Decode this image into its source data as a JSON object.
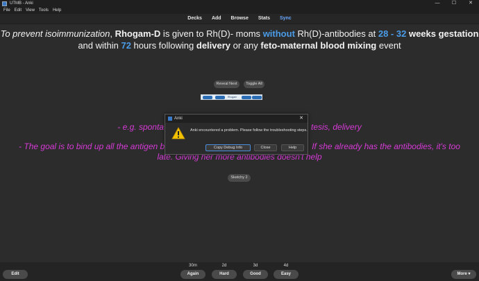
{
  "window": {
    "title": "UTMB - Anki",
    "minimize": "—",
    "maximize": "☐",
    "close": "✕"
  },
  "menu": [
    "File",
    "Edit",
    "View",
    "Tools",
    "Help"
  ],
  "toolbar": {
    "decks": "Decks",
    "add": "Add",
    "browse": "Browse",
    "stats": "Stats",
    "sync": "Sync"
  },
  "card": {
    "l1_a": "To prevent isoimmunization",
    "l1_b": ", ",
    "l1_c": "Rhogam-D",
    "l1_d": " is given to Rh(D)- moms ",
    "l1_e": "without",
    "l1_f": " Rh(D)-antibodies at ",
    "l1_g": "28 - 32",
    "l1_h": " weeks gestation",
    "l2_a": "and within ",
    "l2_b": "72",
    "l2_c": " hours following ",
    "l2_d": "delivery",
    "l2_e": " or any ",
    "l2_f": "feto-maternal blood mixing",
    "l2_g": " event"
  },
  "reveal_next": "Reveal Next",
  "toggle_all": "Toggle All",
  "image_caption": "Rhogam",
  "back": {
    "line1_a": "- e.g. sponta",
    "line1_b": "tesis, delivery",
    "line2_a": "- The goal is to bind up all the antigen b",
    "line2_b": "If she already has the antibodies, it's too",
    "line3": "late. Giving her more antibodies doesn't help"
  },
  "sketchy": "Sketchy 2",
  "dialog": {
    "title": "Anki",
    "message": "Anki encountered a problem. Please follow the troubleshooting steps.",
    "copy_debug": "Copy Debug Info",
    "close": "Close",
    "help": "Help"
  },
  "bottom": {
    "edit": "Edit",
    "more": "More ▾",
    "intervals": [
      "30m",
      "2d",
      "3d",
      "4d"
    ],
    "answers": [
      "Again",
      "Hard",
      "Good",
      "Easy"
    ]
  },
  "colors": {
    "accent_blue": "#4a9be8",
    "pink": "#d63ad6",
    "background": "#2c2c2c"
  }
}
